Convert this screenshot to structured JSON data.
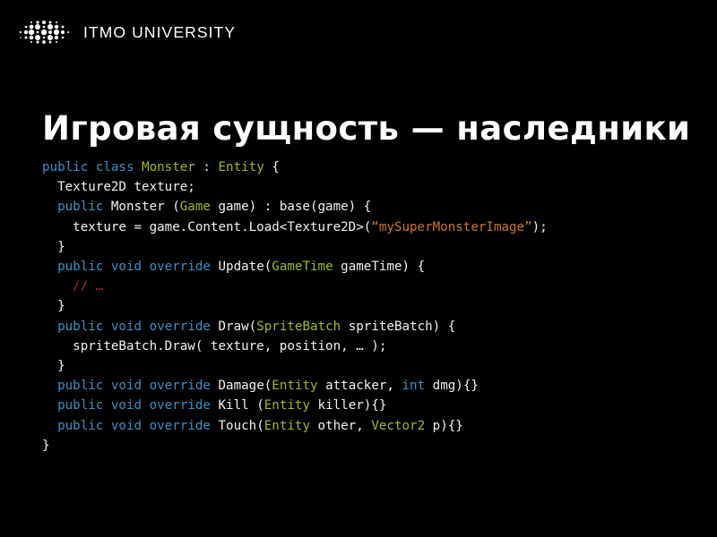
{
  "slide": {
    "background_color": "#000000",
    "brand": {
      "logo_icon": "itmo-dot-matrix-logo",
      "name": "ITMO UNIVERSITY"
    },
    "title": "Игровая сущность — наследники",
    "syntax_colors": {
      "keyword": "#3f8fc4",
      "type": "#9aba2e",
      "string": "#c8762b",
      "comment": "#9e2b2b",
      "plain": "#f2f2f2"
    },
    "code": {
      "language": "csharp",
      "lines": [
        {
          "indent": 0,
          "tokens": [
            {
              "t": "public",
              "k": "kw"
            },
            {
              "t": " ",
              "k": "pln"
            },
            {
              "t": "class",
              "k": "kw"
            },
            {
              "t": " ",
              "k": "pln"
            },
            {
              "t": "Monster",
              "k": "type"
            },
            {
              "t": " : ",
              "k": "pln"
            },
            {
              "t": "Entity",
              "k": "type"
            },
            {
              "t": " {",
              "k": "pln"
            }
          ]
        },
        {
          "indent": 1,
          "tokens": [
            {
              "t": "Texture2D texture;",
              "k": "pln"
            }
          ]
        },
        {
          "indent": 1,
          "tokens": [
            {
              "t": "public",
              "k": "kw"
            },
            {
              "t": " Monster (",
              "k": "pln"
            },
            {
              "t": "Game",
              "k": "type"
            },
            {
              "t": " game) : base(game) {",
              "k": "pln"
            }
          ]
        },
        {
          "indent": 2,
          "tokens": [
            {
              "t": "texture = game.Content.Load<Texture2D>(",
              "k": "pln"
            },
            {
              "t": "“mySuperMonsterImage”",
              "k": "str"
            },
            {
              "t": ");",
              "k": "pln"
            }
          ]
        },
        {
          "indent": 1,
          "tokens": [
            {
              "t": "}",
              "k": "pln"
            }
          ]
        },
        {
          "indent": 1,
          "tokens": [
            {
              "t": "public",
              "k": "kw"
            },
            {
              "t": " ",
              "k": "pln"
            },
            {
              "t": "void",
              "k": "kw"
            },
            {
              "t": " ",
              "k": "pln"
            },
            {
              "t": "override",
              "k": "kw"
            },
            {
              "t": " Update(",
              "k": "pln"
            },
            {
              "t": "GameTime",
              "k": "type"
            },
            {
              "t": " gameTime) {",
              "k": "pln"
            }
          ]
        },
        {
          "indent": 2,
          "tokens": [
            {
              "t": "// …",
              "k": "cmt"
            }
          ]
        },
        {
          "indent": 1,
          "tokens": [
            {
              "t": "}",
              "k": "pln"
            }
          ]
        },
        {
          "indent": 1,
          "tokens": [
            {
              "t": "public",
              "k": "kw"
            },
            {
              "t": " ",
              "k": "pln"
            },
            {
              "t": "void",
              "k": "kw"
            },
            {
              "t": " ",
              "k": "pln"
            },
            {
              "t": "override",
              "k": "kw"
            },
            {
              "t": " Draw(",
              "k": "pln"
            },
            {
              "t": "SpriteBatch",
              "k": "type"
            },
            {
              "t": " spriteBatch) {",
              "k": "pln"
            }
          ]
        },
        {
          "indent": 2,
          "tokens": [
            {
              "t": "spriteBatch.Draw( texture, position, … );",
              "k": "pln"
            }
          ]
        },
        {
          "indent": 1,
          "tokens": [
            {
              "t": "}",
              "k": "pln"
            }
          ]
        },
        {
          "indent": 1,
          "tokens": [
            {
              "t": "public",
              "k": "kw"
            },
            {
              "t": " ",
              "k": "pln"
            },
            {
              "t": "void",
              "k": "kw"
            },
            {
              "t": " ",
              "k": "pln"
            },
            {
              "t": "override",
              "k": "kw"
            },
            {
              "t": " Damage(",
              "k": "pln"
            },
            {
              "t": "Entity",
              "k": "type"
            },
            {
              "t": " attacker, ",
              "k": "pln"
            },
            {
              "t": "int",
              "k": "kw"
            },
            {
              "t": " dmg){}",
              "k": "pln"
            }
          ]
        },
        {
          "indent": 1,
          "tokens": [
            {
              "t": "public",
              "k": "kw"
            },
            {
              "t": " ",
              "k": "pln"
            },
            {
              "t": "void",
              "k": "kw"
            },
            {
              "t": " ",
              "k": "pln"
            },
            {
              "t": "override",
              "k": "kw"
            },
            {
              "t": " Kill (",
              "k": "pln"
            },
            {
              "t": "Entity",
              "k": "type"
            },
            {
              "t": " killer){}",
              "k": "pln"
            }
          ]
        },
        {
          "indent": 1,
          "tokens": [
            {
              "t": "public",
              "k": "kw"
            },
            {
              "t": " ",
              "k": "pln"
            },
            {
              "t": "void",
              "k": "kw"
            },
            {
              "t": " ",
              "k": "pln"
            },
            {
              "t": "override",
              "k": "kw"
            },
            {
              "t": " Touch(",
              "k": "pln"
            },
            {
              "t": "Entity",
              "k": "type"
            },
            {
              "t": " other, ",
              "k": "pln"
            },
            {
              "t": "Vector2",
              "k": "type"
            },
            {
              "t": " p){}",
              "k": "pln"
            }
          ]
        },
        {
          "indent": 0,
          "tokens": [
            {
              "t": "}",
              "k": "pln"
            }
          ]
        }
      ]
    }
  }
}
